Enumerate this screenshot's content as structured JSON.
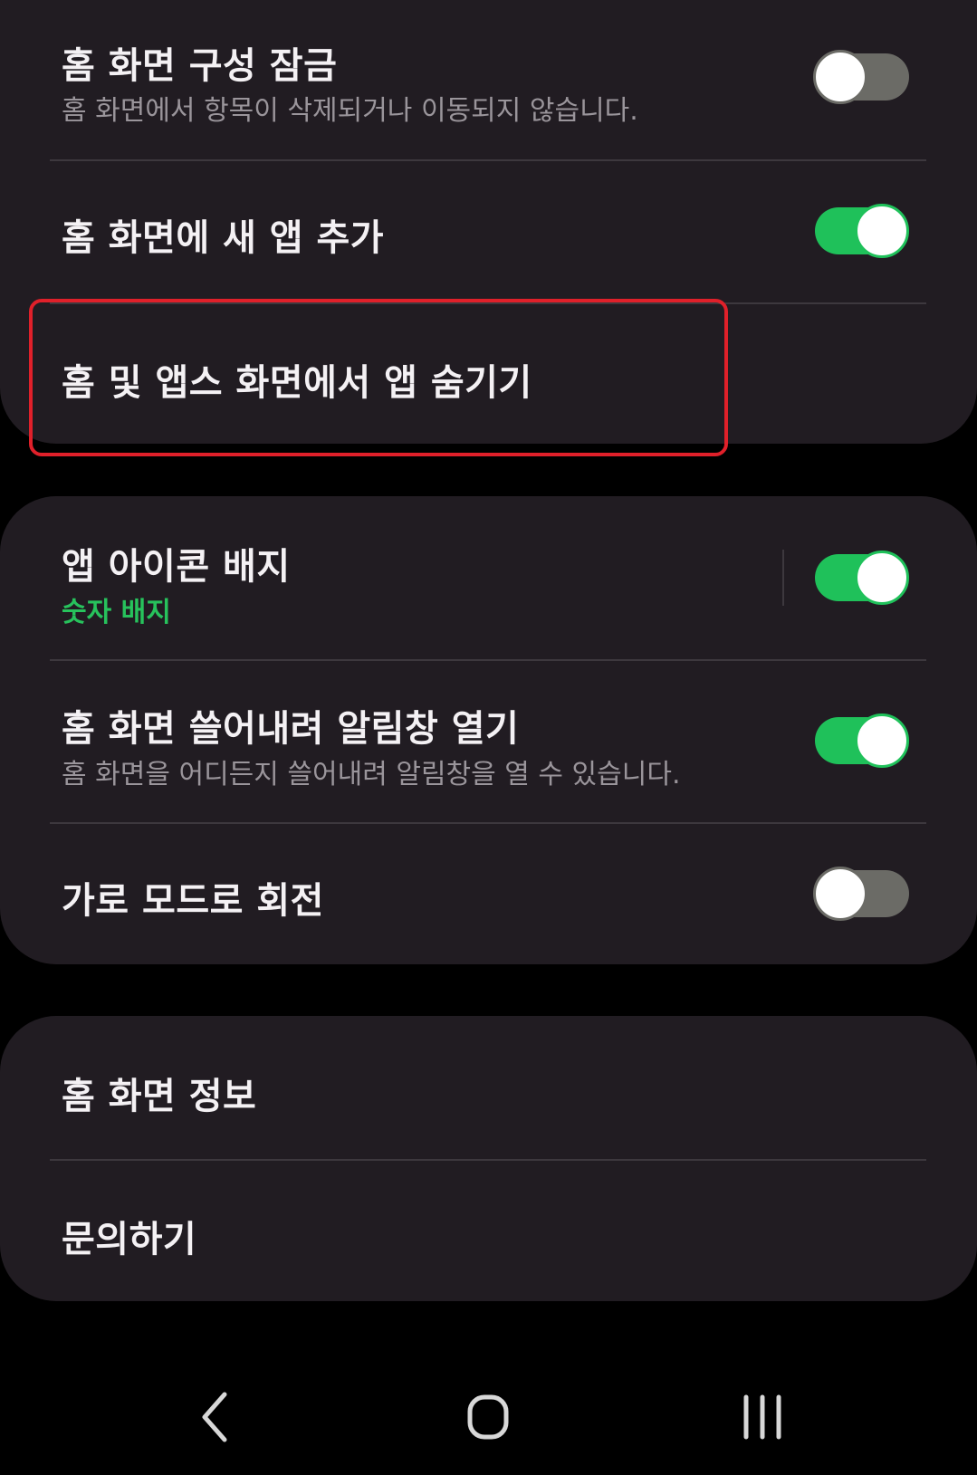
{
  "settings": {
    "lock_layout": {
      "title": "홈 화면 구성 잠금",
      "subtitle": "홈 화면에서 항목이 삭제되거나 이동되지 않습니다.",
      "toggle": "off"
    },
    "add_new_apps": {
      "title": "홈 화면에 새 앱 추가",
      "toggle": "on"
    },
    "hide_apps": {
      "title": "홈 및 앱스 화면에서 앱 숨기기"
    },
    "app_icon_badges": {
      "title": "앱 아이콘 배지",
      "subtitle": "숫자 배지",
      "toggle": "on"
    },
    "swipe_down_notifications": {
      "title": "홈 화면 쓸어내려 알림창 열기",
      "subtitle": "홈 화면을 어디든지 쓸어내려 알림창을 열 수 있습니다.",
      "toggle": "on"
    },
    "rotate_landscape": {
      "title": "가로 모드로 회전",
      "toggle": "off"
    },
    "about_home": {
      "title": "홈 화면 정보"
    },
    "contact_us": {
      "title": "문의하기"
    }
  },
  "navigation": {
    "back_icon": "back-chevron-icon",
    "home_icon": "home-rounded-square-icon",
    "recent_icon": "recent-apps-icon"
  },
  "colors": {
    "background": "#000000",
    "card": "#211c22",
    "toggle_on": "#1fc15a",
    "toggle_off": "#6b6b66",
    "accent_subtitle": "#27c25c",
    "highlight_box": "#e0202a"
  }
}
